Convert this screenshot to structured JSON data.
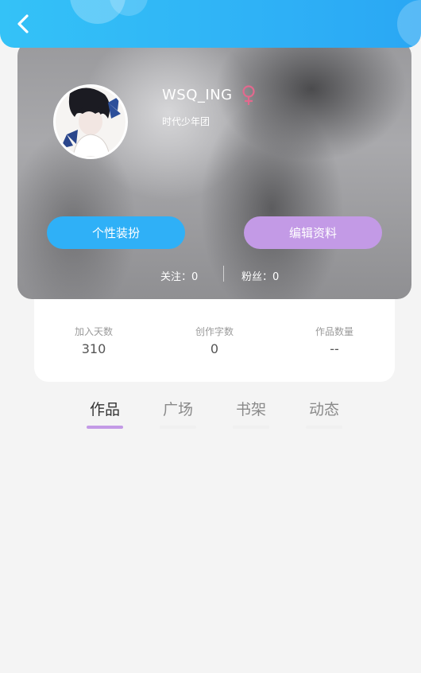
{
  "header": {
    "back_icon": "chevron-left-icon",
    "bg_color": "#2fb2f6"
  },
  "profile": {
    "username": "WSQ_ING",
    "gender_icon": "female-icon",
    "gender_color": "#e2698e",
    "group": "时代少年团",
    "buttons": {
      "dress": "个性装扮",
      "edit": "编辑资料"
    },
    "follow": "关注：0",
    "fans": "粉丝：0"
  },
  "stats": [
    {
      "label": "加入天数",
      "value": "310"
    },
    {
      "label": "创作字数",
      "value": "0"
    },
    {
      "label": "作品数量",
      "value": "--"
    }
  ],
  "tabs": [
    {
      "label": "作品",
      "active": true
    },
    {
      "label": "广场",
      "active": false
    },
    {
      "label": "书架",
      "active": false
    },
    {
      "label": "动态",
      "active": false
    }
  ],
  "colors": {
    "accent_blue": "#2fb0f7",
    "accent_purple": "#c39ae6",
    "background": "#f4f4f4"
  }
}
